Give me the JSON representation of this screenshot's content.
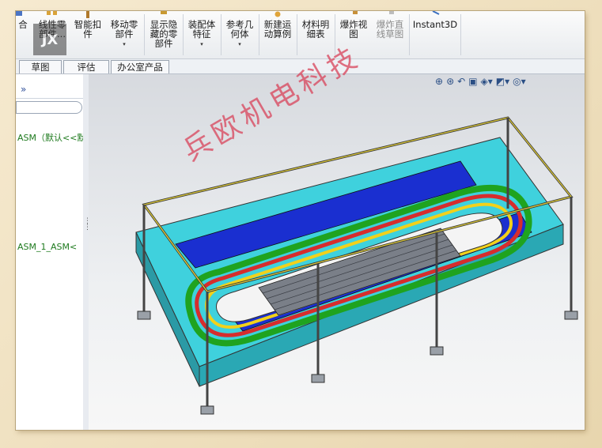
{
  "ribbon": {
    "items": [
      {
        "label": "合",
        "icon": "combine-icon"
      },
      {
        "label": "线性零\n部件...",
        "icon": "linear-pattern-icon"
      },
      {
        "label": "智能扣\n件",
        "icon": "smart-fasteners-icon"
      },
      {
        "label": "移动零\n部件",
        "icon": "move-component-icon",
        "dropdown": "▾"
      },
      {
        "label": "显示隐\n藏的零\n部件",
        "icon": "show-hidden-icon"
      },
      {
        "label": "装配体\n特征",
        "icon": "assembly-features-icon",
        "dropdown": "▾"
      },
      {
        "label": "参考几\n何体",
        "icon": "reference-geometry-icon",
        "dropdown": "▾"
      },
      {
        "label": "新建运\n动算例",
        "icon": "motion-study-icon"
      },
      {
        "label": "材料明\n细表",
        "icon": "bom-icon"
      },
      {
        "label": "爆炸视\n图",
        "icon": "exploded-view-icon"
      },
      {
        "label": "爆炸直\n线草图",
        "icon": "explode-line-sketch-icon",
        "disabled": true
      },
      {
        "label": "Instant3D",
        "icon": "instant3d-icon"
      }
    ]
  },
  "tabs": [
    {
      "label": "草图"
    },
    {
      "label": "评估"
    },
    {
      "label": "办公室产品"
    }
  ],
  "panel": {
    "chevron": "»",
    "tree": [
      {
        "label": "ASM（默认<<默"
      },
      {
        "label": "ASM_1_ASM<"
      }
    ]
  },
  "view_toolbar": {
    "icons": [
      "zoom-to-fit-icon",
      "zoom-area-icon",
      "previous-view-icon",
      "section-view-icon",
      "view-orientation-icon",
      "display-style-icon",
      "hide-show-items-icon"
    ]
  },
  "watermark": "兵欧机电科技",
  "logo": "JX"
}
